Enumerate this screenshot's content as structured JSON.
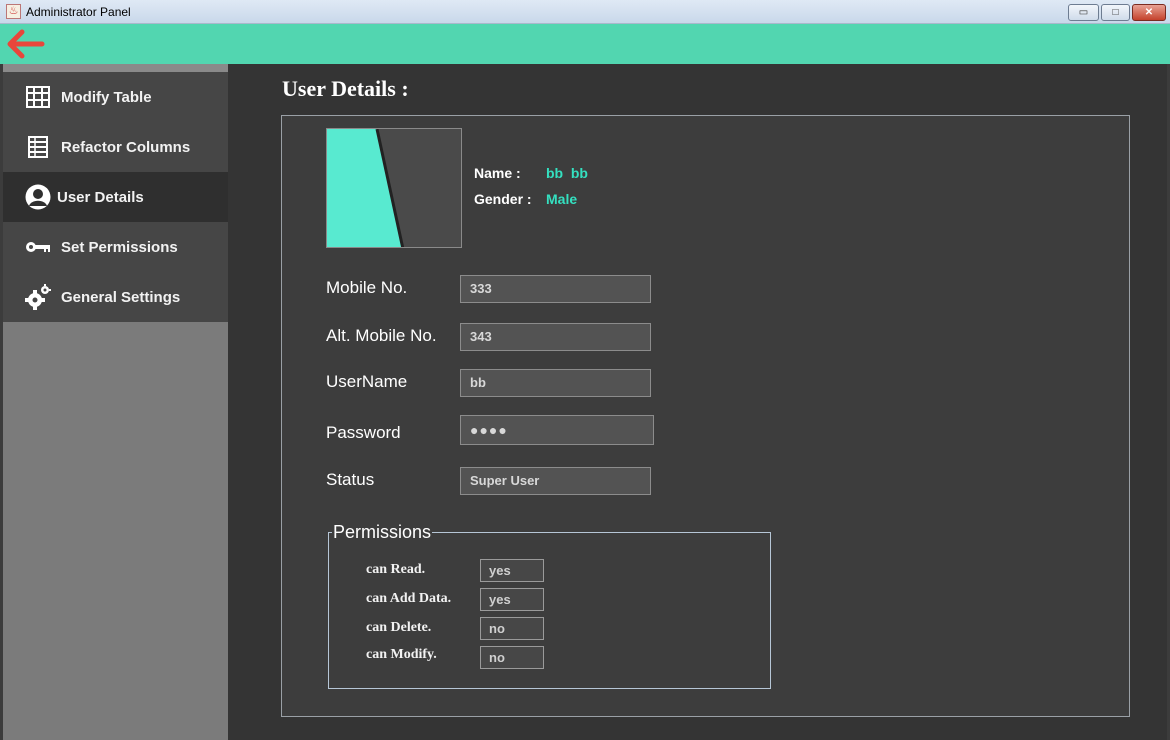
{
  "window": {
    "title": "Administrator Panel",
    "controls": {
      "minimize": "▭",
      "maximize": "□",
      "close": "✕"
    }
  },
  "topbar": {
    "back_icon": "arrow-left-icon",
    "accent": "#52d6b0",
    "arrow_color": "#e8463b"
  },
  "sidebar": {
    "items": [
      {
        "label": "Modify Table",
        "icon": "table-grid-icon"
      },
      {
        "label": "Refactor Columns",
        "icon": "columns-icon"
      },
      {
        "label": "User Details",
        "icon": "user-icon",
        "active": true
      },
      {
        "label": "Set Permissions",
        "icon": "key-icon"
      },
      {
        "label": "General Settings",
        "icon": "gears-icon"
      }
    ]
  },
  "main": {
    "title": "User Details :",
    "profile": {
      "name_label": "Name :",
      "name_value": "bb  bb",
      "gender_label": "Gender :",
      "gender_value": "Male"
    },
    "fields": {
      "mobile": {
        "label": "Mobile No.",
        "value": "333"
      },
      "alt_mobile": {
        "label": "Alt. Mobile No.",
        "value": "343"
      },
      "username": {
        "label": "UserName",
        "value": "bb"
      },
      "password": {
        "label": "Password",
        "value": "●●●●"
      },
      "status": {
        "label": "Status",
        "value": "Super User"
      }
    },
    "permissions": {
      "legend": "Permissions",
      "items": [
        {
          "label": "can Read.",
          "value": "yes"
        },
        {
          "label": "can Add Data.",
          "value": "yes"
        },
        {
          "label": "can Delete.",
          "value": "no"
        },
        {
          "label": "can Modify.",
          "value": "no"
        }
      ]
    }
  },
  "colors": {
    "accent_text": "#34e0c0",
    "panel_bg": "#3d3d3d",
    "sidebar_active": "#2f2f2f"
  }
}
